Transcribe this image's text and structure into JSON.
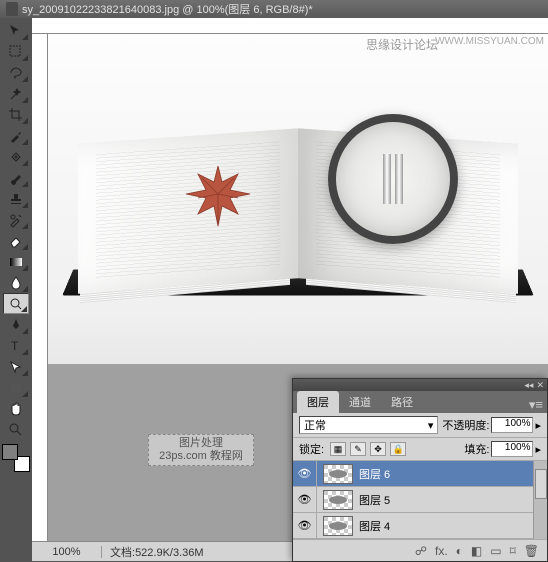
{
  "title": "sy_20091022233821640083.jpg @ 100%(图层 6, RGB/8#)*",
  "watermark_top": "思缘设计论坛",
  "watermark_url": "WWW.MISSYUAN.COM",
  "watermark_box_l1": "图片处理",
  "watermark_box_l2": "23ps.com 教程网",
  "status": {
    "zoom": "100%",
    "doc_label": "文档:",
    "doc_size": "522.9K/3.36M"
  },
  "panel": {
    "tabs": [
      "图层",
      "通道",
      "路径"
    ],
    "blend_mode": "正常",
    "opacity_label": "不透明度:",
    "opacity_value": "100%",
    "lock_label": "锁定:",
    "fill_label": "填充:",
    "fill_value": "100%",
    "layers": [
      {
        "name": "图层 6",
        "selected": true
      },
      {
        "name": "图层 5",
        "selected": false
      },
      {
        "name": "图层 4",
        "selected": false
      }
    ],
    "footer_icons": [
      "☍",
      "fx.",
      "◐",
      "◧",
      "▭",
      "⌑",
      "🗑"
    ]
  },
  "tools": [
    "move",
    "marquee",
    "lasso",
    "wand",
    "crop",
    "eyedropper",
    "healing",
    "brush",
    "stamp",
    "history",
    "eraser",
    "gradient",
    "blur",
    "dodge",
    "pen",
    "type",
    "path",
    "rectangle",
    "hand",
    "zoom"
  ]
}
